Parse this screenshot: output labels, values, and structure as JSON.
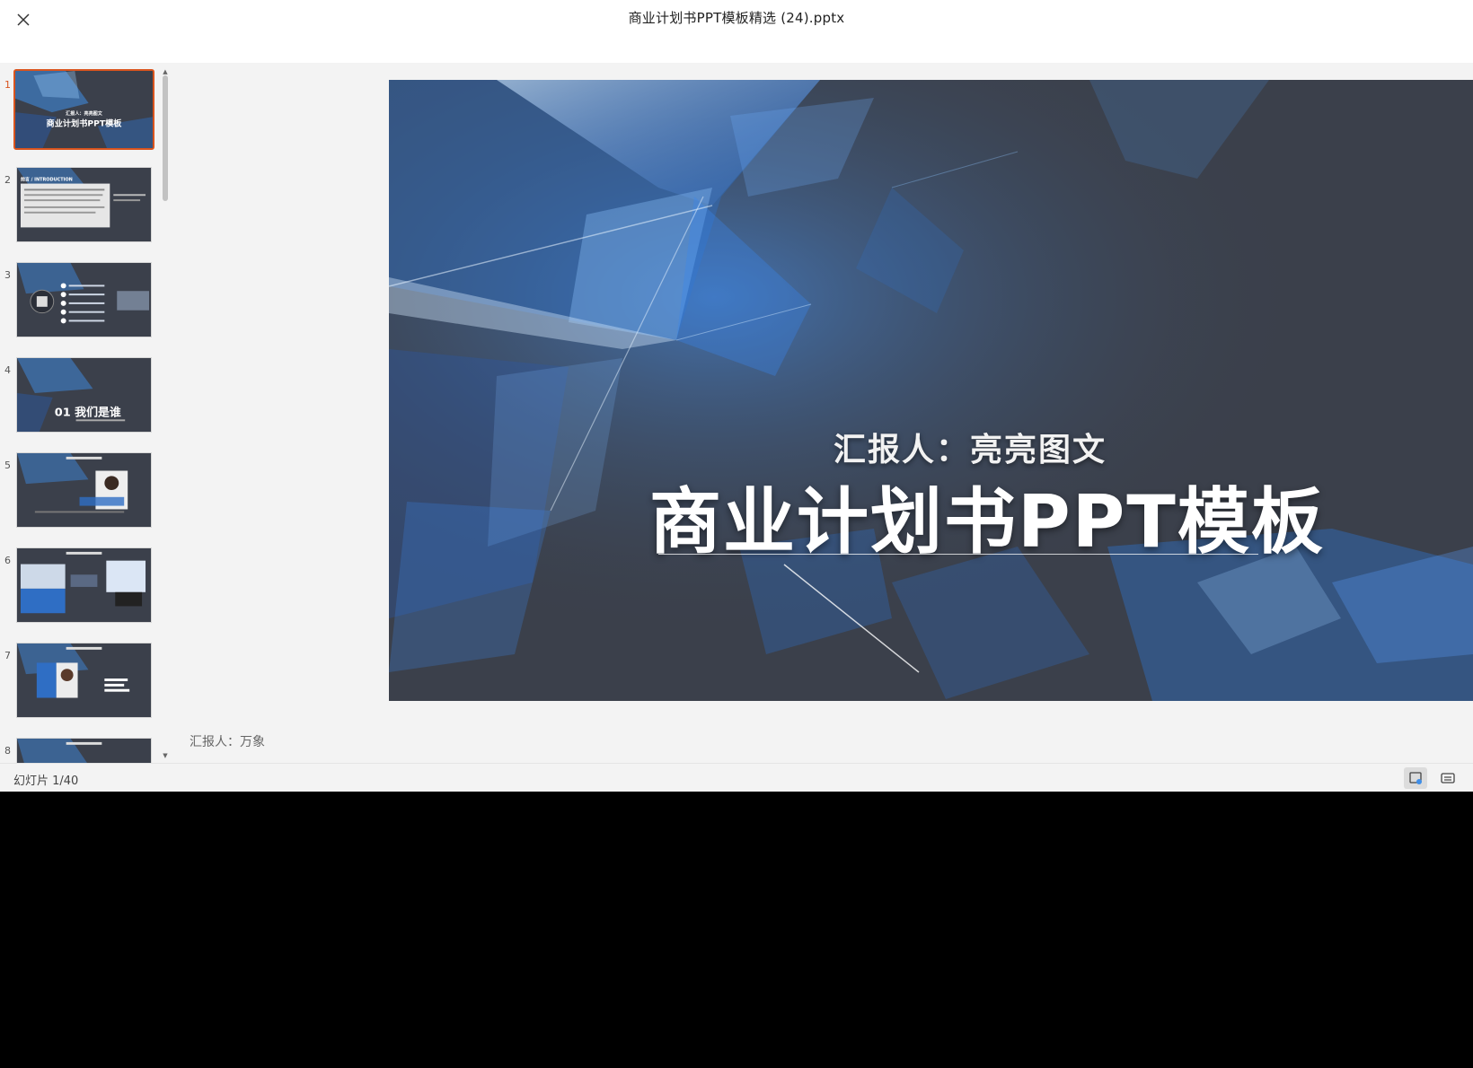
{
  "window": {
    "title": "商业计划书PPT模板精选 (24).pptx"
  },
  "thumbnails": [
    {
      "num": "1",
      "caption_small": "汇报人：亮亮图文",
      "caption": "商业计划书PPT模板",
      "active": true
    },
    {
      "num": "2",
      "caption": "前言 / INTRODUCTION"
    },
    {
      "num": "3"
    },
    {
      "num": "4",
      "caption": "01 我们是谁"
    },
    {
      "num": "5"
    },
    {
      "num": "6"
    },
    {
      "num": "7"
    },
    {
      "num": "8"
    }
  ],
  "slide": {
    "subtitle": "汇报人：亮亮图文",
    "title": "商业计划书PPT模板"
  },
  "notes": "汇报人：万象",
  "status": {
    "counter": "幻灯片 1/40"
  },
  "colors": {
    "accent": "#d9541e",
    "slide_bg": "#3b404b",
    "crystal_blue": "#3f8ee8"
  }
}
